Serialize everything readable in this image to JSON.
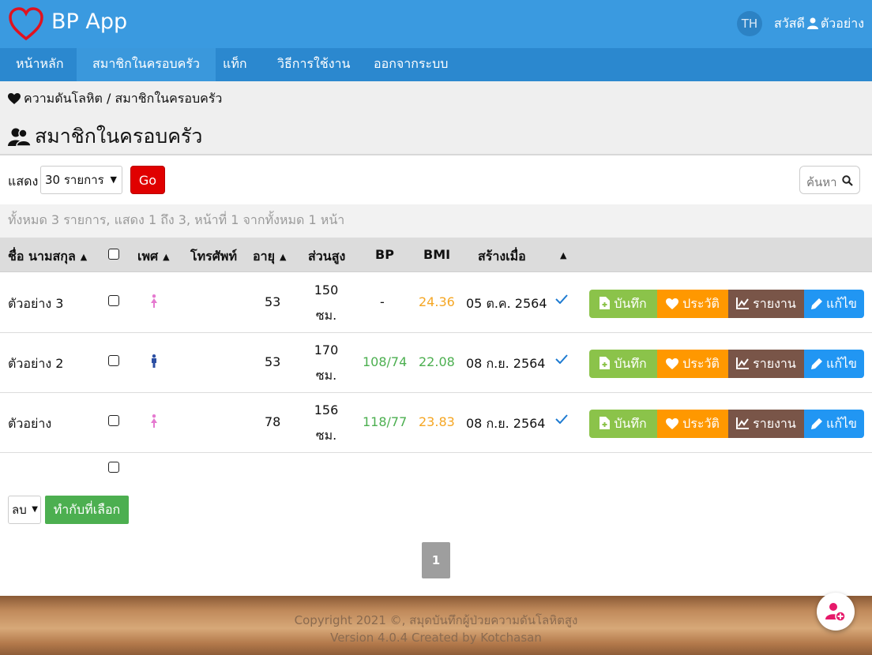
{
  "header": {
    "app_title": "BP App",
    "lang": "TH",
    "greeting": "สวัสดี",
    "user_name": "ตัวอย่าง"
  },
  "nav": {
    "home": "หน้าหลัก",
    "family": "สมาชิกในครอบครัว",
    "tags": "แท็ก",
    "howto": "วิธีการใช้งาน",
    "logout": "ออกจากระบบ"
  },
  "breadcrumb": {
    "root": "ความดันโลหิต",
    "sep": "/",
    "current": "สมาชิกในครอบครัว"
  },
  "page_title": "สมาชิกในครอบครัว",
  "toolbar": {
    "show_label": "แสดง",
    "per_page": "30 รายการ",
    "go_label": "Go",
    "search_placeholder": "ค้นหา"
  },
  "summary": "ทั้งหมด 3 รายการ, แสดง 1 ถึง 3, หน้าที่ 1 จากทั้งหมด 1 หน้า",
  "table": {
    "headers": {
      "name": "ชื่อ นามสกุล",
      "sex": "เพศ",
      "phone": "โทรศัพท์",
      "age": "อายุ",
      "height": "ส่วนสูง",
      "bp": "BP",
      "bmi": "BMI",
      "created": "สร้างเมื่อ"
    },
    "rows": [
      {
        "name": "ตัวอย่าง 3",
        "sex": "female",
        "age": "53",
        "height": "150",
        "height_unit": "ซม.",
        "bp": "-",
        "bmi": "24.36",
        "created": "05 ต.ค. 2564"
      },
      {
        "name": "ตัวอย่าง 2",
        "sex": "male",
        "age": "53",
        "height": "170",
        "height_unit": "ซม.",
        "bp": "108/74",
        "bmi": "22.08",
        "created": "08 ก.ย. 2564"
      },
      {
        "name": "ตัวอย่าง",
        "sex": "female",
        "age": "78",
        "height": "156",
        "height_unit": "ซม.",
        "bp": "118/77",
        "bmi": "23.83",
        "created": "08 ก.ย. 2564"
      }
    ],
    "actions": {
      "record": "บันทึก",
      "history": "ประวัติ",
      "report": "รายงาน",
      "edit": "แก้ไข"
    }
  },
  "bulk": {
    "action": "ลบ",
    "apply_label": "ทำกับที่เลือก"
  },
  "pagination": {
    "current": "1"
  },
  "footer": {
    "line1": "Copyright 2021 ©, สมุดบันทึกผู้ป่วยความดันโลหิตสูง",
    "line2": "Version 4.0.4 Created by Kotchasan"
  },
  "colors": {
    "header": "#3a9ae0",
    "nav": "#2b88cf",
    "bp_value": "#4caf50",
    "bmi_orange": "#f5a623",
    "bmi_green": "#4caf50",
    "female": "#e57ad0",
    "male": "#2c4fa3",
    "check": "#1e7bd1"
  }
}
